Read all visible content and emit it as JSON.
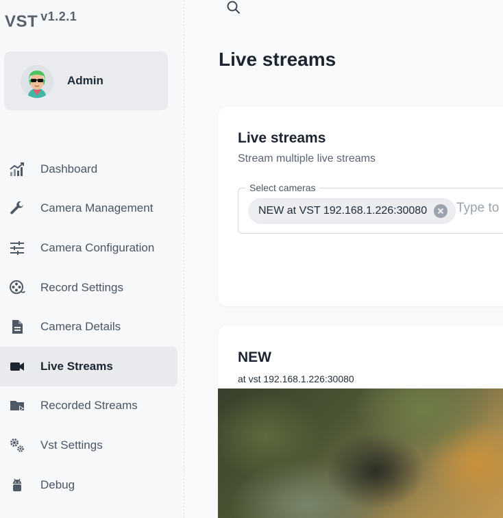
{
  "brand": {
    "name": "VST",
    "version": "v1.2.1"
  },
  "user": {
    "name": "Admin",
    "avatar_icon": "avatar-cartoon-icon"
  },
  "sidebar": {
    "items": [
      {
        "label": "Dashboard",
        "icon": "chart-icon",
        "active": false
      },
      {
        "label": "Camera Management",
        "icon": "wrench-icon",
        "active": false
      },
      {
        "label": "Camera Configuration",
        "icon": "sliders-icon",
        "active": false
      },
      {
        "label": "Record Settings",
        "icon": "film-reel-icon",
        "active": false
      },
      {
        "label": "Camera Details",
        "icon": "document-icon",
        "active": false
      },
      {
        "label": "Live Streams",
        "icon": "videocam-icon",
        "active": true
      },
      {
        "label": "Recorded Streams",
        "icon": "folder-play-icon",
        "active": false
      },
      {
        "label": "Vst Settings",
        "icon": "gears-icon",
        "active": false
      },
      {
        "label": "Debug",
        "icon": "android-icon",
        "active": false
      }
    ]
  },
  "header": {
    "search_icon": "search-icon"
  },
  "page": {
    "title": "Live streams"
  },
  "live_card": {
    "title": "Live streams",
    "subtitle": "Stream multiple live streams",
    "select_label": "Select cameras",
    "selected_chip": "NEW at VST 192.168.1.226:30080",
    "input_placeholder": "Type to"
  },
  "stream_card": {
    "title": "NEW",
    "subtitle": "at vst 192.168.1.226:30080"
  },
  "colors": {
    "active_bg": "#e8eaed",
    "card_bg": "#ffffff",
    "page_bg": "#f8f9fb"
  }
}
